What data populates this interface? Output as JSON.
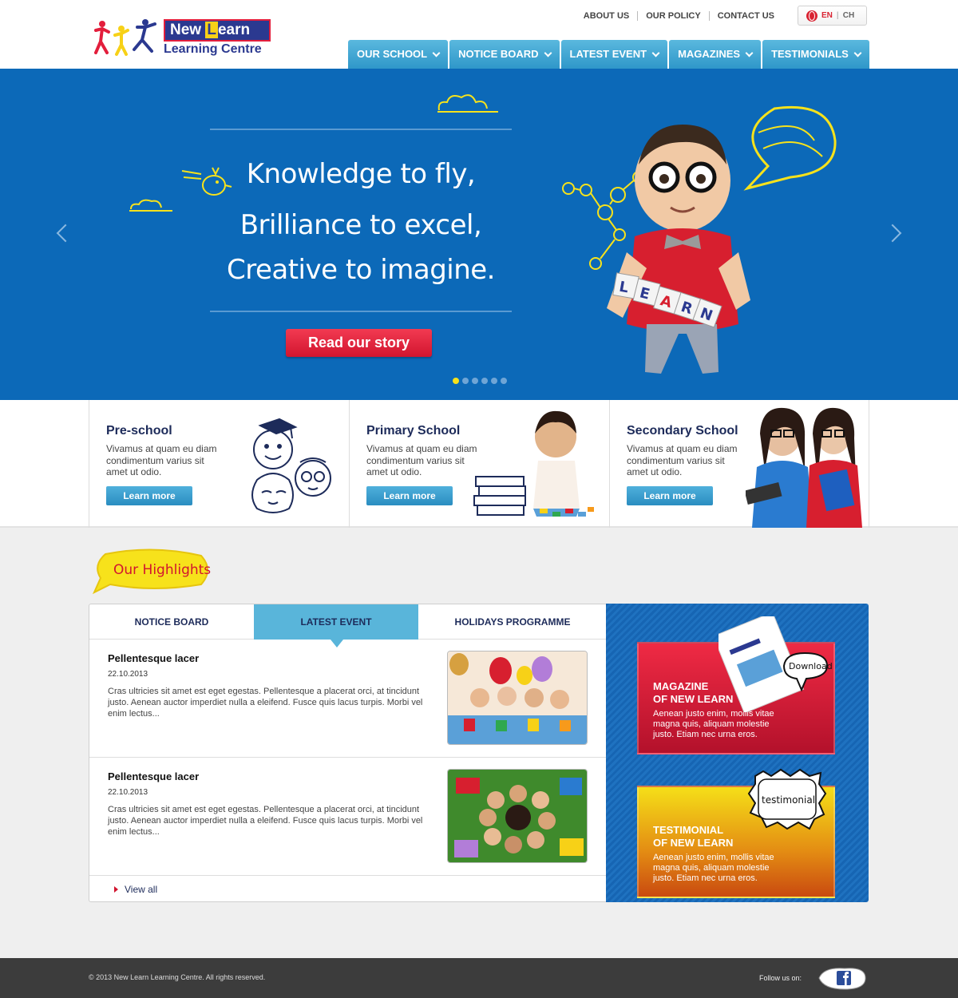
{
  "logo": {
    "line1_a": "New ",
    "line1_b": "L",
    "line1_c": "earn",
    "line2": "Learning Centre"
  },
  "top_links": [
    "ABOUT US",
    "OUR POLICY",
    "CONTACT US"
  ],
  "lang": {
    "en": "EN",
    "ch": "CH"
  },
  "nav": [
    "OUR SCHOOL",
    "NOTICE BOARD",
    "LATEST EVENT",
    "MAGAZINES",
    "TESTIMONIALS"
  ],
  "hero": {
    "line1": "Knowledge to fly,",
    "line2": "Brilliance to excel,",
    "line3": "Creative to imagine.",
    "cta": "Read our story",
    "blocks": "LEARN",
    "slide_count": 6,
    "active_slide": 1
  },
  "schools": [
    {
      "title": "Pre-school",
      "desc": "Vivamus at quam eu diam condimentum varius sit amet ut odio.",
      "button": "Learn more"
    },
    {
      "title": "Primary School",
      "desc": "Vivamus at quam eu diam condimentum varius sit amet ut odio.",
      "button": "Learn more"
    },
    {
      "title": "Secondary School",
      "desc": "Vivamus at quam eu diam condimentum varius sit amet ut odio.",
      "button": "Learn more"
    }
  ],
  "highlights": {
    "title": "Our Highlights",
    "tabs": [
      "NOTICE BOARD",
      "LATEST EVENT",
      "HOLIDAYS PROGRAMME"
    ],
    "active_tab": 1,
    "events": [
      {
        "title": "Pellentesque lacer",
        "date": "22.10.2013",
        "desc": "Cras ultricies sit amet est eget egestas. Pellentesque a placerat orci, at tincidunt justo.  Aenean auctor imperdiet nulla a eleifend. Fusce quis lacus turpis. Morbi vel enim lectus..."
      },
      {
        "title": "Pellentesque lacer",
        "date": "22.10.2013",
        "desc": "Cras ultricies sit amet est eget egestas. Pellentesque a placerat orci, at tincidunt justo.  Aenean auctor imperdiet nulla a eleifend. Fusce quis lacus turpis. Morbi vel enim lectus..."
      }
    ],
    "view_all": "View all"
  },
  "promos": {
    "magazine": {
      "title1": "MAGAZINE",
      "title2": "OF NEW LEARN",
      "desc": "Aenean justo enim, mollis vitae magna quis, aliquam molestie justo. Etiam nec urna eros.",
      "bubble": "Download"
    },
    "testimonial": {
      "title1": "TESTIMONIAL",
      "title2": "OF NEW LEARN",
      "desc": "Aenean justo enim, mollis vitae magna quis, aliquam molestie justo. Etiam nec urna eros.",
      "bubble": "testimonial"
    }
  },
  "footer": {
    "copyright": "© 2013 New Learn Learning Centre. All rights reserved.",
    "follow": "Follow us on:"
  },
  "colors": {
    "brand_blue": "#0c69b8",
    "nav_blue": "#3ea6d3",
    "red": "#d2152f",
    "yellow": "#f7e21b",
    "navy": "#1d2b5a"
  },
  "icons": [
    "globe-icon",
    "chevron-down-icon",
    "arrow-left-icon",
    "arrow-right-icon",
    "facebook-icon",
    "bullet-arrow-icon"
  ]
}
